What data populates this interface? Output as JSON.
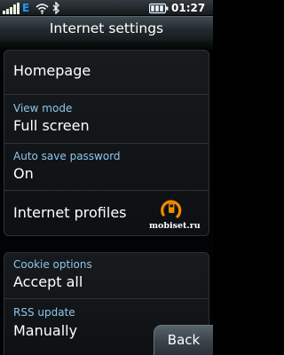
{
  "status_bar": {
    "network_type": "E",
    "time": "01:27",
    "icons": [
      "signal-strength-icon",
      "edge-network-icon",
      "wifi-icon",
      "bluetooth-icon",
      "battery-icon"
    ]
  },
  "header": {
    "title": "Internet settings"
  },
  "settings_group_1": [
    {
      "label": "",
      "value": "Homepage"
    },
    {
      "label": "View mode",
      "value": "Full screen"
    },
    {
      "label": "Auto save password",
      "value": "On"
    },
    {
      "label": "",
      "value": "Internet profiles"
    }
  ],
  "settings_group_2": [
    {
      "label": "Cookie options",
      "value": "Accept all"
    },
    {
      "label": "RSS update",
      "value": "Manually"
    }
  ],
  "watermark": {
    "text": "mobiset.ru"
  },
  "softkeys": {
    "back_label": "Back"
  },
  "colors": {
    "label_blue": "#8fc6ec",
    "edge_blue": "#1a9aff",
    "watermark_orange": "#f08a00"
  }
}
